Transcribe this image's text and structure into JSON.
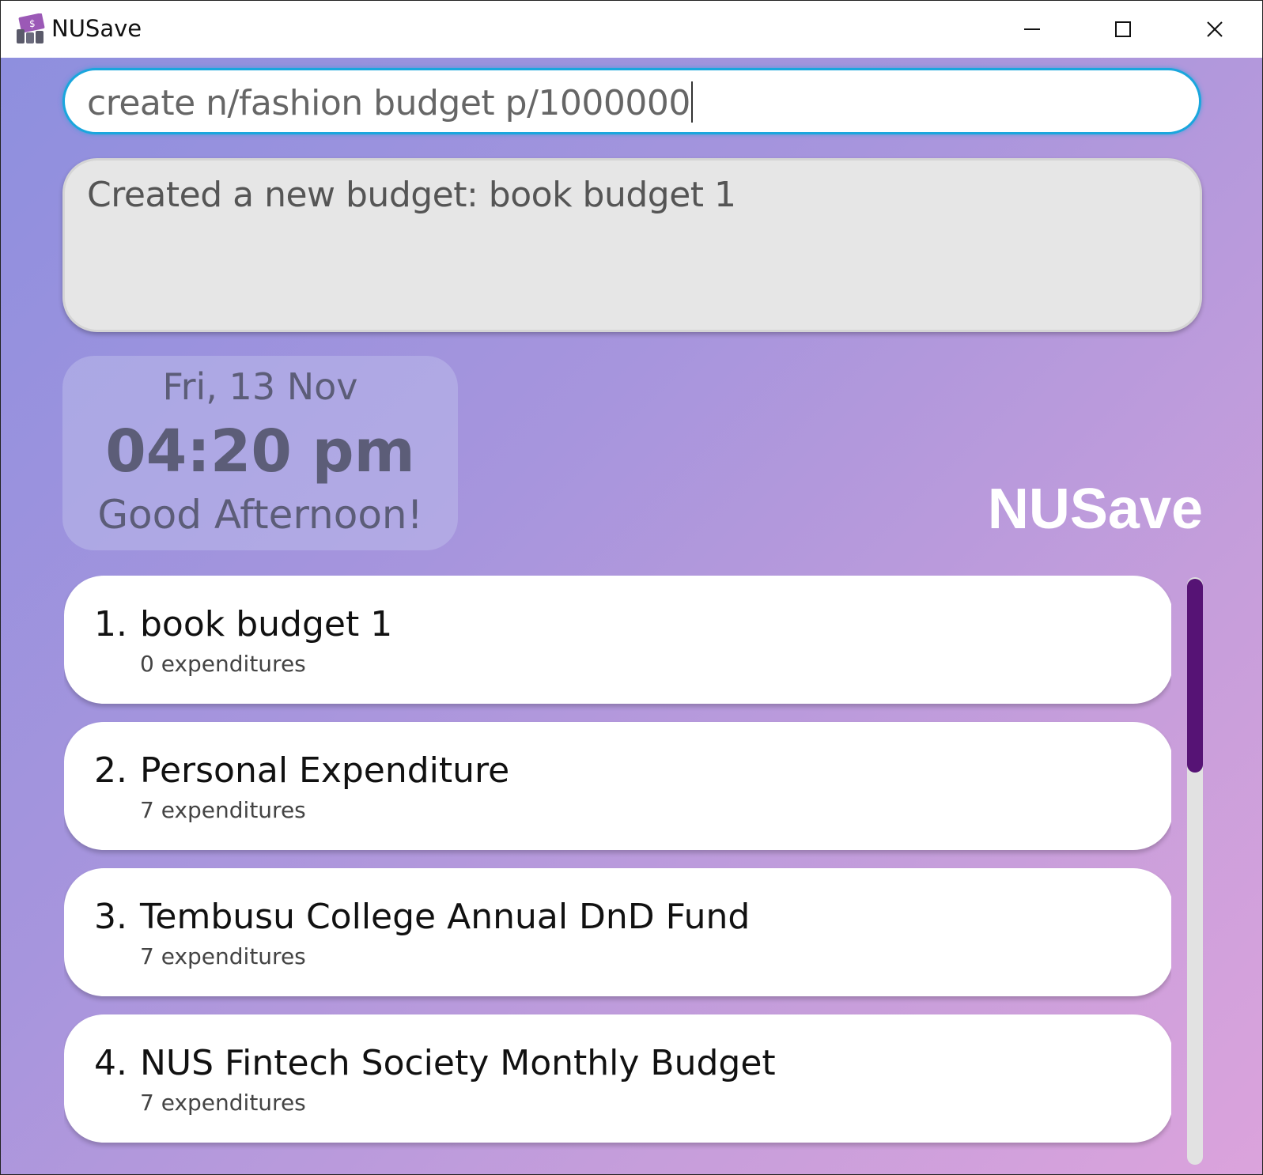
{
  "window": {
    "title": "NUSave",
    "icon": "money-stack-icon"
  },
  "command_box": {
    "value": "create n/fashion budget p/1000000"
  },
  "result_display": {
    "text": "Created a new budget: book budget 1"
  },
  "clock": {
    "date": "Fri, 13 Nov",
    "time": "04:20 pm",
    "greeting": "Good Afternoon!"
  },
  "brand": {
    "label": "NUSave"
  },
  "budgets": [
    {
      "index": "1.",
      "name": "book budget 1",
      "expenditures": "0 expenditures"
    },
    {
      "index": "2.",
      "name": "Personal Expenditure",
      "expenditures": "7 expenditures"
    },
    {
      "index": "3.",
      "name": "Tembusu College Annual DnD Fund",
      "expenditures": "7 expenditures"
    },
    {
      "index": "4.",
      "name": "NUS Fintech Society Monthly Budget",
      "expenditures": "7 expenditures"
    }
  ],
  "colors": {
    "accent": "#1aa6dd",
    "scroll_thumb": "#561375",
    "text_muted": "#5c5d78"
  }
}
